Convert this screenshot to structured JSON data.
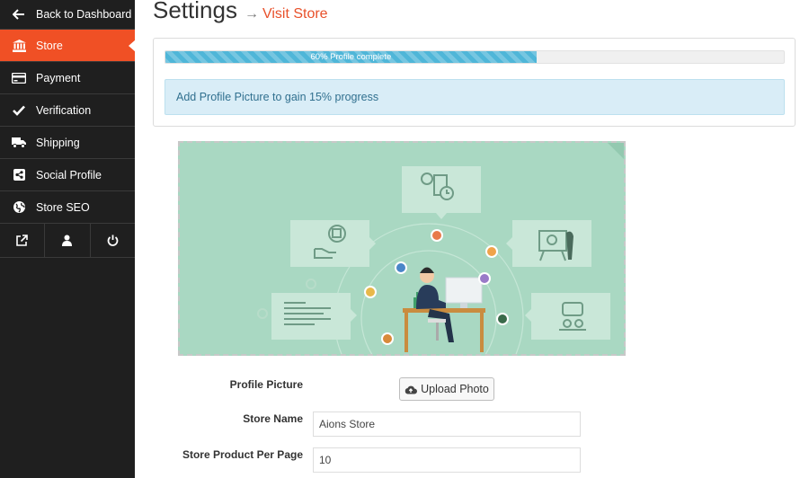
{
  "sidebar": {
    "back_label": "Back to Dashboard",
    "items": [
      {
        "label": "Store",
        "icon": "bank-icon"
      },
      {
        "label": "Payment",
        "icon": "credit-card-icon"
      },
      {
        "label": "Verification",
        "icon": "check-icon"
      },
      {
        "label": "Shipping",
        "icon": "truck-icon"
      },
      {
        "label": "Social Profile",
        "icon": "share-square-icon"
      },
      {
        "label": "Store SEO",
        "icon": "globe-icon"
      }
    ],
    "active_item": "Store",
    "bottom_icons": [
      "external-link-icon",
      "user-icon",
      "power-icon"
    ],
    "colors": {
      "background": "#1f1f1f",
      "active": "#f05025"
    }
  },
  "header": {
    "title": "Settings",
    "arrow": "→",
    "link_label": "Visit Store"
  },
  "progress": {
    "percent": 60,
    "label": "60% Profile complete",
    "tip": "Add Profile Picture to gain 15% progress"
  },
  "form": {
    "profile_picture_label": "Profile Picture",
    "upload_button_label": "Upload Photo",
    "store_name_label": "Store Name",
    "store_name_value": "Aions Store",
    "per_page_label": "Store Product Per Page",
    "per_page_value": "10"
  }
}
